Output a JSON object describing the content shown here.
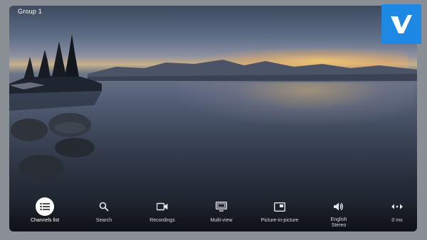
{
  "header": {
    "group_label": "Group 1"
  },
  "logo": {
    "name": "app-logo",
    "color": "#1e88e5"
  },
  "controls": [
    {
      "name": "channels-list",
      "label": "Channels list",
      "icon": "list-icon",
      "active": true
    },
    {
      "name": "search",
      "label": "Search",
      "icon": "search-icon",
      "active": false
    },
    {
      "name": "recordings",
      "label": "Recordings",
      "icon": "video-camera-icon",
      "active": false
    },
    {
      "name": "multi-view",
      "label": "Multi-view",
      "icon": "monitor-icon",
      "active": false
    },
    {
      "name": "picture-in-picture",
      "label": "Picture-in-picture",
      "icon": "picture-in-picture-icon",
      "active": false
    },
    {
      "name": "audio-track",
      "label": "English Stereo",
      "icon": "volume-icon",
      "active": false
    },
    {
      "name": "audio-delay",
      "label": "0 ms",
      "icon": "delay-arrows-icon",
      "active": false
    }
  ]
}
